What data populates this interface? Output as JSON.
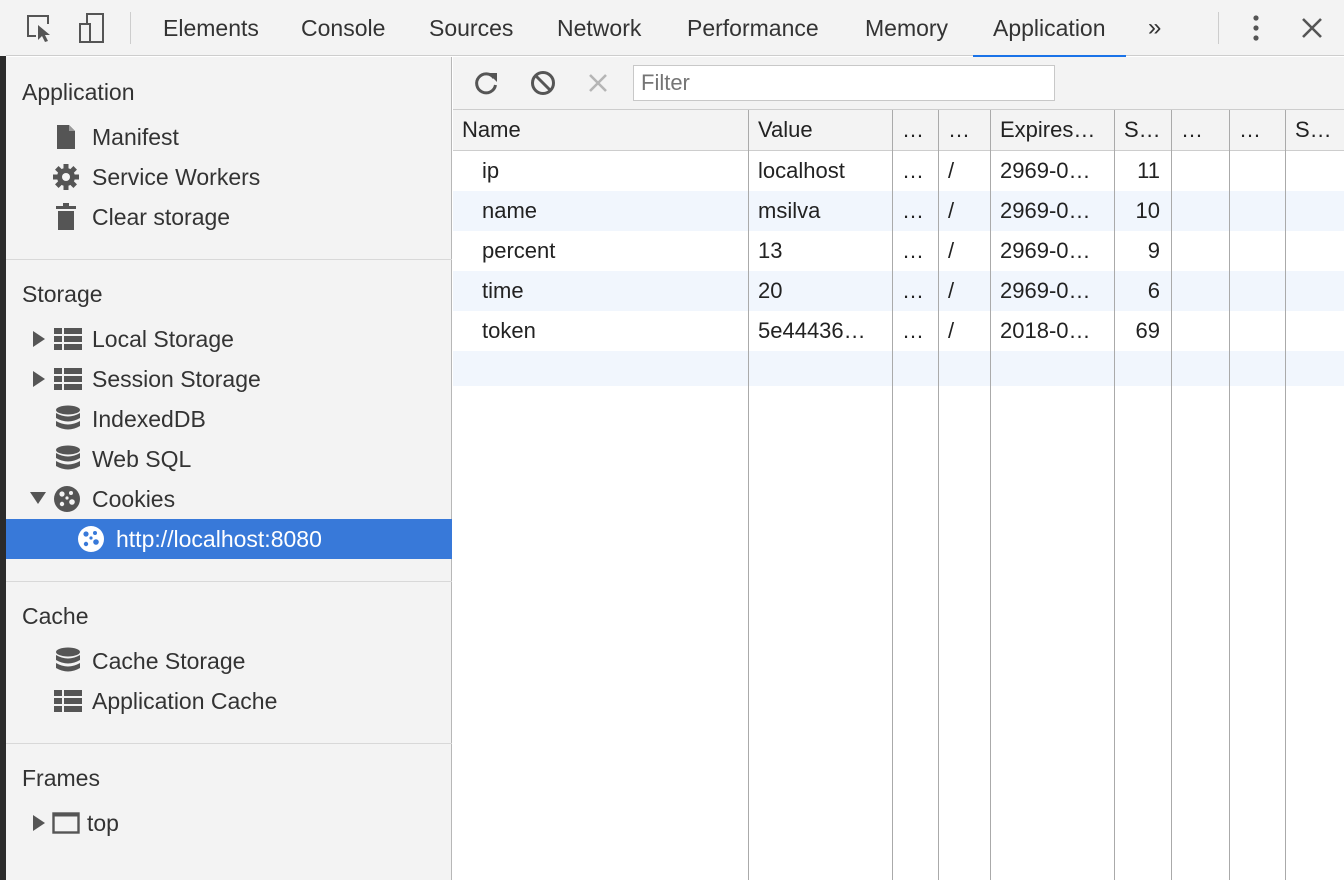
{
  "tabbar": {
    "tabs": [
      "Elements",
      "Console",
      "Sources",
      "Network",
      "Performance",
      "Memory",
      "Application"
    ],
    "active_tab": "Application",
    "more_label": "»"
  },
  "sidebar": {
    "application": {
      "title": "Application",
      "items": [
        "Manifest",
        "Service Workers",
        "Clear storage"
      ]
    },
    "storage": {
      "title": "Storage",
      "items": [
        "Local Storage",
        "Session Storage",
        "IndexedDB",
        "Web SQL",
        "Cookies"
      ],
      "cookie_origin": "http://localhost:8080"
    },
    "cache": {
      "title": "Cache",
      "items": [
        "Cache Storage",
        "Application Cache"
      ]
    },
    "frames": {
      "title": "Frames",
      "items": [
        "top"
      ]
    }
  },
  "toolbar": {
    "filter_placeholder": "Filter"
  },
  "cookies_table": {
    "headers": [
      "Name",
      "Value",
      "…",
      "…",
      "Expires…",
      "S…",
      "…",
      "…",
      "S…"
    ],
    "rows": [
      [
        "ip",
        "localhost",
        "…",
        "/",
        "2969-0…",
        "11",
        "",
        "",
        ""
      ],
      [
        "name",
        "msilva",
        "…",
        "/",
        "2969-0…",
        "10",
        "",
        "",
        ""
      ],
      [
        "percent",
        "13",
        "…",
        "/",
        "2969-0…",
        "9",
        "",
        "",
        ""
      ],
      [
        "time",
        "20",
        "…",
        "/",
        "2969-0…",
        "6",
        "",
        "",
        ""
      ],
      [
        "token",
        "5e44436…",
        "…",
        "/",
        "2018-0…",
        "69",
        "",
        "",
        ""
      ]
    ]
  },
  "colors": {
    "selected_bg": "#3879d9",
    "active_tab_underline": "#1a73e8",
    "panel_bg": "#f3f3f3"
  }
}
